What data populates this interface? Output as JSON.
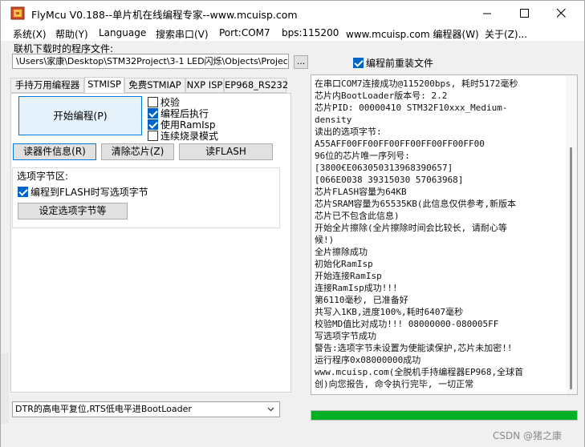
{
  "window": {
    "title": "FlyMcu V0.188--单片机在线编程专家--www.mcuisp.com"
  },
  "menu": [
    "系统(X)",
    "帮助(Y)",
    "Language",
    "搜索串口(V)",
    "Port:COM7",
    "bps:115200",
    "www.mcuisp.com 编程器(W)",
    "关于(Z)..."
  ],
  "file": {
    "label": "联机下载时的程序文件:",
    "path": "\\Users\\家康\\Desktop\\STM32Project\\3-1 LED闪烁\\Objects\\Project.hex",
    "browse_label": "...",
    "reload_label": "编程前重装文件",
    "reload_checked": true
  },
  "tabs": [
    "手持万用编程器",
    "STMISP",
    "免费STMIAP",
    "NXP ISP",
    "EP968_RS232"
  ],
  "active_tab": "STMISP",
  "stmisp": {
    "start_label": "开始编程(P)",
    "options": [
      {
        "label": "校验",
        "checked": false
      },
      {
        "label": "编程后执行",
        "checked": true
      },
      {
        "label": "使用RamIsp",
        "checked": true
      },
      {
        "label": "连续烧录模式",
        "checked": false
      }
    ],
    "read_info_label": "读器件信息(R)",
    "erase_label": "清除芯片(Z)",
    "read_flash_label": "读FLASH",
    "option_group": {
      "title": "选项字节区:",
      "write_option_label": "编程到FLASH时写选项字节",
      "write_option_checked": true,
      "set_option_label": "设定选项字节等"
    }
  },
  "dtr_mode": "DTR的高电平复位,RTS低电平进BootLoader",
  "log": [
    "在串口COM7连接成功@115200bps, 耗时5172毫秒",
    "芯片内BootLoader版本号: 2.2",
    "芯片PID: 00000410  STM32F10xxx_Medium-",
    "density",
    "读出的选项字节:",
    "A55AFF00FF00FF00FF00FF00FF00FF00",
    "96位的芯片唯一序列号:",
    "[3800€E063050313968390657]",
    "[066E0038 39315030 57063968]",
    "芯片FLASH容量为64KB",
    "芯片SRAM容量为65535KB(此信息仅供参考,新版本",
    "芯片已不包含此信息)",
    "开始全片擦除(全片擦除时间会比较长, 请耐心等",
    "候!)",
    "全片擦除成功",
    "初始化RamIsp",
    "开始连接RamIsp",
    "连接RamIsp成功!!!",
    "第6110毫秒, 已准备好",
    "共写入1KB,进度100%,耗时6407毫秒",
    "校验MD值比对成功!!! 08000000-080005FF",
    "写选项字节成功",
    "警告:选项字节未设置为使能读保护,芯片未加密!!",
    "运行程序0x08000000成功",
    "www.mcuisp.com(全脱机手持编程器EP968,全球首",
    "创)向您报告, 命令执行完毕, 一切正常"
  ],
  "progress_percent": 100,
  "colors": {
    "progress": "#06b025",
    "accent": "#0078d7",
    "check": "#0063c7"
  },
  "watermark": "CSDN @猪之康"
}
